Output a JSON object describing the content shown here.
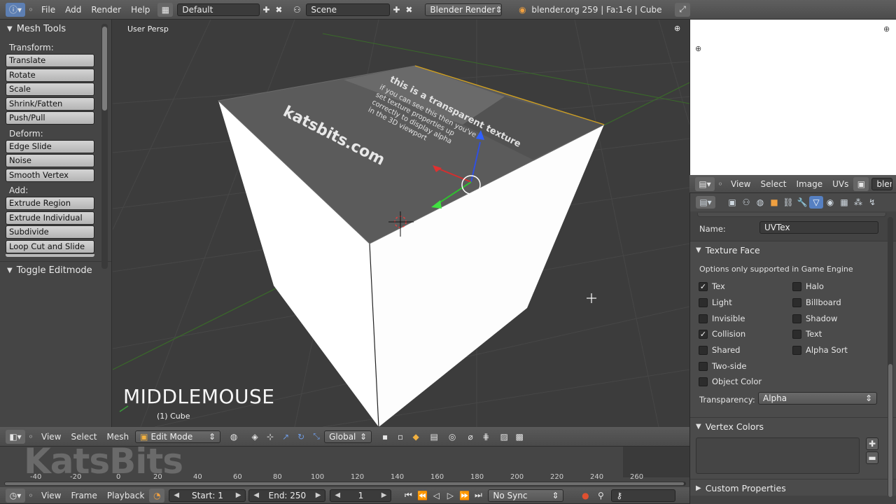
{
  "top": {
    "menus": [
      "File",
      "Add",
      "Render",
      "Help"
    ],
    "layout": "Default",
    "scene": "Scene",
    "engine": "Blender Render",
    "stats": "blender.org 259 | Fa:1-6 | Cube"
  },
  "toolshelf": {
    "title": "Mesh Tools",
    "groups": [
      {
        "label": "Transform:",
        "buttons": [
          "Translate",
          "Rotate",
          "Scale",
          "Shrink/Fatten",
          "Push/Pull"
        ]
      },
      {
        "label": "Deform:",
        "buttons": [
          "Edge Slide",
          "Noise",
          "Smooth Vertex"
        ]
      },
      {
        "label": "Add:",
        "buttons": [
          "Extrude Region",
          "Extrude Individual",
          "Subdivide",
          "Loop Cut and Slide"
        ]
      }
    ],
    "toggle_panel": "Toggle Editmode"
  },
  "viewport": {
    "view_label": "User Persp",
    "overlay_key": "MIDDLEMOUSE",
    "object_label": "(1) Cube",
    "texture_lines": [
      "this is a transparent texture",
      "if you can see this then you've",
      "set texture properties up",
      "correctly to display alpha",
      "in the 3D viewport"
    ],
    "texture_brand": "katsbits.com"
  },
  "vp_header": {
    "menus": [
      "View",
      "Select",
      "Mesh"
    ],
    "mode": "Edit Mode",
    "orientation": "Global"
  },
  "timeline": {
    "ticks": [
      "-40",
      "-20",
      "0",
      "20",
      "40",
      "60",
      "80",
      "100",
      "120",
      "140",
      "160",
      "180",
      "200",
      "220",
      "240",
      "260"
    ],
    "watermark": "KatsBits",
    "menus": [
      "View",
      "Frame",
      "Playback"
    ],
    "start": "Start: 1",
    "end": "End: 250",
    "current": "1",
    "sync": "No Sync"
  },
  "uv_header": {
    "menus": [
      "View",
      "Select",
      "Image",
      "UVs"
    ],
    "image_name": "blend"
  },
  "properties": {
    "name_label": "Name:",
    "name_value": "UVTex",
    "texture_face_title": "Texture Face",
    "note": "Options only supported in Game Engine",
    "left_options": [
      {
        "label": "Tex",
        "checked": true
      },
      {
        "label": "Light",
        "checked": false
      },
      {
        "label": "Invisible",
        "checked": false
      },
      {
        "label": "Collision",
        "checked": true
      },
      {
        "label": "Shared",
        "checked": false
      },
      {
        "label": "Two-side",
        "checked": false
      },
      {
        "label": "Object Color",
        "checked": false
      }
    ],
    "right_options": [
      {
        "label": "Halo",
        "checked": false
      },
      {
        "label": "Billboard",
        "checked": false
      },
      {
        "label": "Shadow",
        "checked": false
      },
      {
        "label": "Text",
        "checked": false
      },
      {
        "label": "Alpha Sort",
        "checked": false
      }
    ],
    "transparency_label": "Transparency:",
    "transparency_value": "Alpha",
    "vertex_colors_title": "Vertex Colors",
    "custom_props_title": "Custom Properties"
  }
}
